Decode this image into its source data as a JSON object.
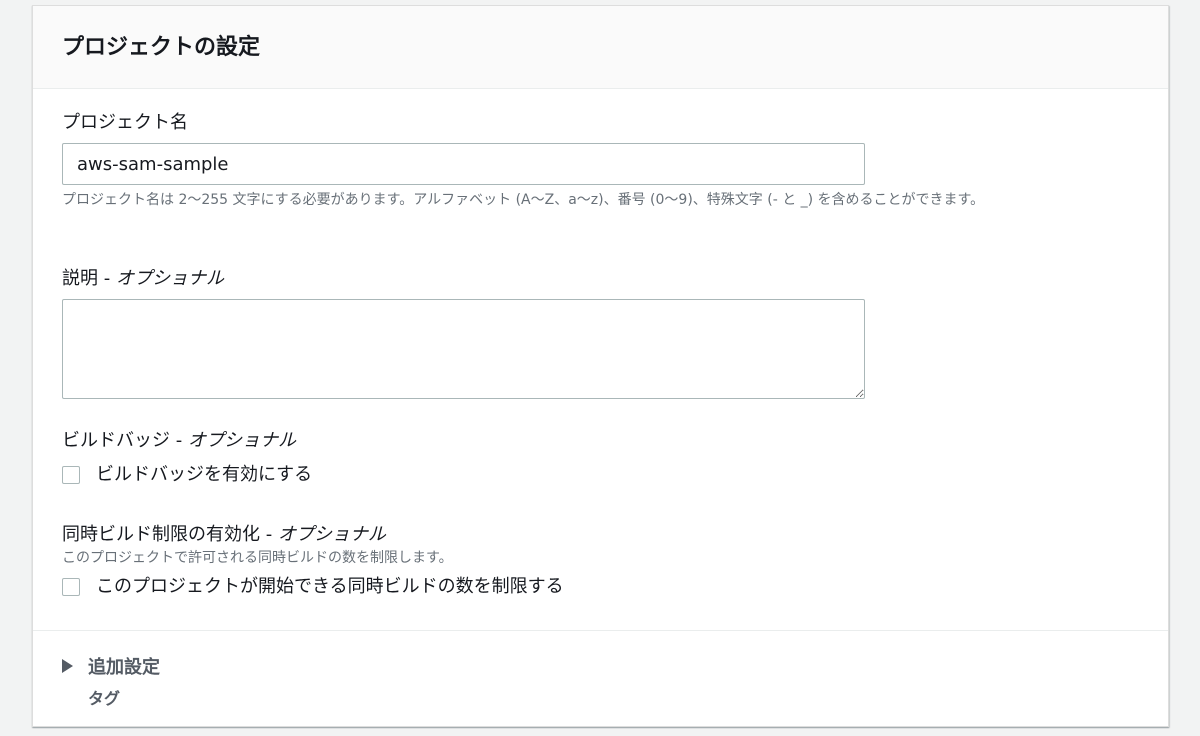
{
  "panel": {
    "title": "プロジェクトの設定"
  },
  "project_name": {
    "label": "プロジェクト名",
    "value": "aws-sam-sample",
    "hint": "プロジェクト名は 2〜255 文字にする必要があります。アルファベット (A〜Z、a〜z)、番号 (0〜9)、特殊文字 (- と _) を含めることができます。"
  },
  "description": {
    "label": "説明 - ",
    "optional": "オプショナル",
    "value": ""
  },
  "build_badge": {
    "label": "ビルドバッジ - ",
    "optional": "オプショナル",
    "checkbox_label": "ビルドバッジを有効にする",
    "checked": false
  },
  "concurrent_limit": {
    "label": "同時ビルド制限の有効化 - ",
    "optional": "オプショナル",
    "hint": "このプロジェクトで許可される同時ビルドの数を制限します。",
    "checkbox_label": "このプロジェクトが開始できる同時ビルドの数を制限する",
    "checked": false
  },
  "additional": {
    "label": "追加設定",
    "sub": "タグ"
  }
}
